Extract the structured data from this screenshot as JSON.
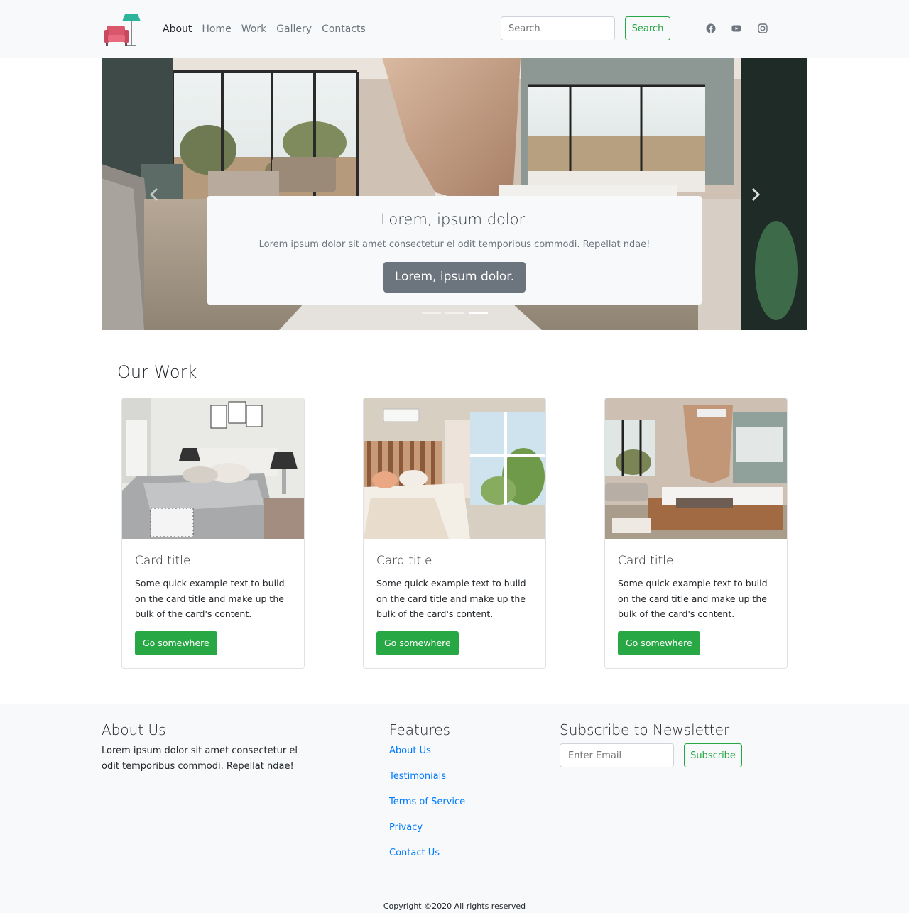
{
  "nav": {
    "items": [
      {
        "label": "About",
        "active": true
      },
      {
        "label": "Home",
        "active": false
      },
      {
        "label": "Work",
        "active": false
      },
      {
        "label": "Gallery",
        "active": false
      },
      {
        "label": "Contacts",
        "active": false
      }
    ],
    "search_placeholder": "Search",
    "search_button": "Search",
    "social_icons": [
      "facebook-icon",
      "youtube-icon",
      "instagram-icon"
    ]
  },
  "hero": {
    "caption_title": "Lorem, ipsum dolor.",
    "caption_text": "Lorem ipsum dolor sit amet consectetur el odit temporibus commodi. Repellat ndae!",
    "caption_button": "Lorem, ipsum dolor.",
    "slides_count": 3,
    "active_slide": 3
  },
  "work": {
    "title": "Our Work",
    "cards": [
      {
        "title": "Card title",
        "text": "Some quick example text to build on the card title and make up the bulk of the card's content.",
        "button": "Go somewhere"
      },
      {
        "title": "Card title",
        "text": "Some quick example text to build on the card title and make up the bulk of the card's content.",
        "button": "Go somewhere"
      },
      {
        "title": "Card title",
        "text": "Some quick example text to build on the card title and make up the bulk of the card's content.",
        "button": "Go somewhere"
      }
    ]
  },
  "footer": {
    "about_title": "About Us",
    "about_text": "Lorem ipsum dolor sit amet consectetur el odit temporibus commodi. Repellat ndae!",
    "features_title": "Features",
    "features": [
      "About Us",
      "Testimonials",
      "Terms of Service",
      "Privacy",
      "Contact Us"
    ],
    "newsletter_title": "Subscribe to Newsletter",
    "email_placeholder": "Enter Email",
    "subscribe_button": "Subscribe",
    "copyright": "Copyright ©2020 All rights reserved"
  },
  "colors": {
    "brand_green": "#28a745",
    "link_blue": "#007bff",
    "muted_gray": "#6c757d",
    "light_bg": "#f8f9fa"
  }
}
